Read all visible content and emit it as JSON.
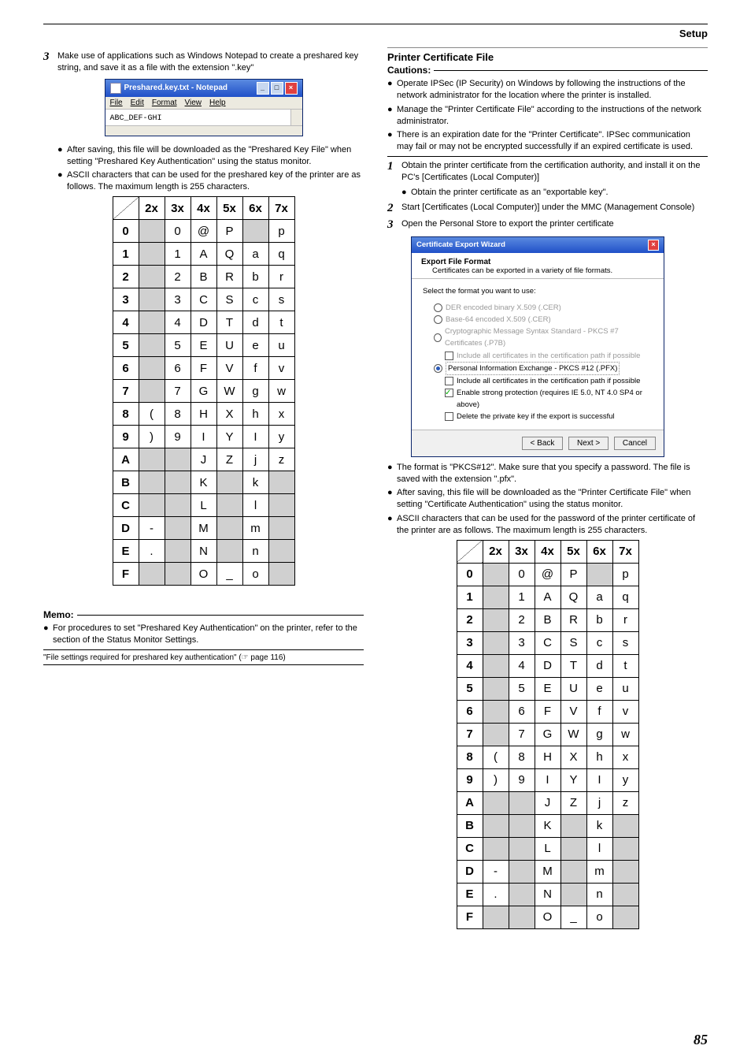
{
  "header": {
    "section": "Setup"
  },
  "left": {
    "step3_num": "3",
    "step3_text": "Make use of applications such as Windows Notepad to create a preshared key string, and save it as a file with the extension \".key\"",
    "notepad": {
      "title": "Preshared.key.txt - Notepad",
      "menus": [
        "File",
        "Edit",
        "Format",
        "View",
        "Help"
      ],
      "content": "ABC_DEF-GHI"
    },
    "bullets": [
      "After saving, this file will be downloaded as the \"Preshared Key File\" when setting \"Preshared Key Authentication\" using the status monitor.",
      "ASCII characters that can be used for the preshared key of the printer are as follows. The maximum length is 255 characters."
    ],
    "memo_title": "Memo:",
    "memo_bullet": "For procedures to set \"Preshared Key Authentication\" on the printer, refer to the section of the Status Monitor Settings.",
    "memo_link": "\"File settings required for preshared key authentication\" (☞ page 116)"
  },
  "right": {
    "h_title": "Printer Certificate File",
    "cautions_title": "Cautions:",
    "cautions": [
      "Operate IPSec (IP Security) on Windows by following the instructions of the network administrator for the location where the printer is installed.",
      "Manage the \"Printer Certificate File\" according to the instructions of the network administrator.",
      "There is an expiration date for the \"Printer Certificate\". IPSec communication may fail or may not be encrypted successfully if an expired certificate is used."
    ],
    "step1_num": "1",
    "step1_text": "Obtain the printer certificate from the certification authority, and install it on the PC's [Certificates (Local Computer)]",
    "step1_bullet": "Obtain the printer certificate as an \"exportable key\".",
    "step2_num": "2",
    "step2_text": "Start [Certificates (Local Computer)] under the MMC (Management Console)",
    "step3_num": "3",
    "step3_text": "Open the Personal Store to export the printer certificate",
    "wizard": {
      "title": "Certificate Export Wizard",
      "head_b": "Export File Format",
      "head_t": "Certificates can be exported in a variety of file formats.",
      "prompt": "Select the format you want to use:",
      "opt1": "DER encoded binary X.509 (.CER)",
      "opt2": "Base-64 encoded X.509 (.CER)",
      "opt3": "Cryptographic Message Syntax Standard - PKCS #7 Certificates (.P7B)",
      "opt3c": "Include all certificates in the certification path if possible",
      "opt4": "Personal Information Exchange - PKCS #12 (.PFX)",
      "opt4c1": "Include all certificates in the certification path if possible",
      "opt4c2": "Enable strong protection (requires IE 5.0, NT 4.0 SP4 or above)",
      "opt4c3": "Delete the private key if the export is successful",
      "btn_back": "< Back",
      "btn_next": "Next >",
      "btn_cancel": "Cancel"
    },
    "after_bullets": [
      "The format is \"PKCS#12\". Make sure that you specify a password. The file is saved with the extension \".pfx\".",
      "After saving, this file will be downloaded as the \"Printer Certificate File\" when setting \"Certificate Authentication\" using the status monitor.",
      "ASCII characters that can be used for the password of the printer certificate of the printer are as follows. The maximum length is 255 characters."
    ]
  },
  "ascii": {
    "cols": [
      "2x",
      "3x",
      "4x",
      "5x",
      "6x",
      "7x"
    ],
    "rows": [
      {
        "h": "0",
        "c": [
          {
            "v": "",
            "s": 1
          },
          {
            "v": "0"
          },
          {
            "v": "@"
          },
          {
            "v": "P"
          },
          {
            "v": "",
            "s": 1
          },
          {
            "v": "p"
          }
        ]
      },
      {
        "h": "1",
        "c": [
          {
            "v": "",
            "s": 1
          },
          {
            "v": "1"
          },
          {
            "v": "A"
          },
          {
            "v": "Q"
          },
          {
            "v": "a"
          },
          {
            "v": "q"
          }
        ]
      },
      {
        "h": "2",
        "c": [
          {
            "v": "",
            "s": 1
          },
          {
            "v": "2"
          },
          {
            "v": "B"
          },
          {
            "v": "R"
          },
          {
            "v": "b"
          },
          {
            "v": "r"
          }
        ]
      },
      {
        "h": "3",
        "c": [
          {
            "v": "",
            "s": 1
          },
          {
            "v": "3"
          },
          {
            "v": "C"
          },
          {
            "v": "S"
          },
          {
            "v": "c"
          },
          {
            "v": "s"
          }
        ]
      },
      {
        "h": "4",
        "c": [
          {
            "v": "",
            "s": 1
          },
          {
            "v": "4"
          },
          {
            "v": "D"
          },
          {
            "v": "T"
          },
          {
            "v": "d"
          },
          {
            "v": "t"
          }
        ]
      },
      {
        "h": "5",
        "c": [
          {
            "v": "",
            "s": 1
          },
          {
            "v": "5"
          },
          {
            "v": "E"
          },
          {
            "v": "U"
          },
          {
            "v": "e"
          },
          {
            "v": "u"
          }
        ]
      },
      {
        "h": "6",
        "c": [
          {
            "v": "",
            "s": 1
          },
          {
            "v": "6"
          },
          {
            "v": "F"
          },
          {
            "v": "V"
          },
          {
            "v": "f"
          },
          {
            "v": "v"
          }
        ]
      },
      {
        "h": "7",
        "c": [
          {
            "v": "",
            "s": 1
          },
          {
            "v": "7"
          },
          {
            "v": "G"
          },
          {
            "v": "W"
          },
          {
            "v": "g"
          },
          {
            "v": "w"
          }
        ]
      },
      {
        "h": "8",
        "c": [
          {
            "v": "("
          },
          {
            "v": "8"
          },
          {
            "v": "H"
          },
          {
            "v": "X"
          },
          {
            "v": "h"
          },
          {
            "v": "x"
          }
        ]
      },
      {
        "h": "9",
        "c": [
          {
            "v": ")"
          },
          {
            "v": "9"
          },
          {
            "v": "I"
          },
          {
            "v": "Y"
          },
          {
            "v": "I"
          },
          {
            "v": "y"
          }
        ]
      },
      {
        "h": "A",
        "c": [
          {
            "v": "",
            "s": 1
          },
          {
            "v": "",
            "s": 1
          },
          {
            "v": "J"
          },
          {
            "v": "Z"
          },
          {
            "v": "j"
          },
          {
            "v": "z"
          }
        ]
      },
      {
        "h": "B",
        "c": [
          {
            "v": "",
            "s": 1
          },
          {
            "v": "",
            "s": 1
          },
          {
            "v": "K"
          },
          {
            "v": "",
            "s": 1
          },
          {
            "v": "k"
          },
          {
            "v": "",
            "s": 1
          }
        ]
      },
      {
        "h": "C",
        "c": [
          {
            "v": "",
            "s": 1
          },
          {
            "v": "",
            "s": 1
          },
          {
            "v": "L"
          },
          {
            "v": "",
            "s": 1
          },
          {
            "v": "l"
          },
          {
            "v": "",
            "s": 1
          }
        ]
      },
      {
        "h": "D",
        "c": [
          {
            "v": "-"
          },
          {
            "v": "",
            "s": 1
          },
          {
            "v": "M"
          },
          {
            "v": "",
            "s": 1
          },
          {
            "v": "m"
          },
          {
            "v": "",
            "s": 1
          }
        ]
      },
      {
        "h": "E",
        "c": [
          {
            "v": "."
          },
          {
            "v": "",
            "s": 1
          },
          {
            "v": "N"
          },
          {
            "v": "",
            "s": 1
          },
          {
            "v": "n"
          },
          {
            "v": "",
            "s": 1
          }
        ]
      },
      {
        "h": "F",
        "c": [
          {
            "v": "",
            "s": 1
          },
          {
            "v": "",
            "s": 1
          },
          {
            "v": "O"
          },
          {
            "v": "_"
          },
          {
            "v": "o"
          },
          {
            "v": "",
            "s": 1
          }
        ]
      }
    ]
  },
  "page_number": "85"
}
